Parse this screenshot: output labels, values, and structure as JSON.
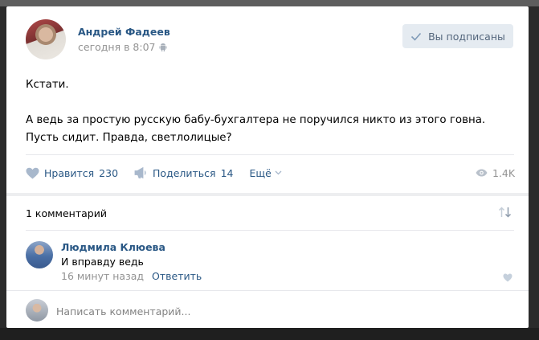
{
  "post": {
    "author_name": "Андрей Фадеев",
    "timestamp": "сегодня в 8:07",
    "platform_icon": "android-icon",
    "subscribe_label": "Вы подписаны",
    "text_lines": [
      "Кстати.",
      "А ведь за простую русскую бабу-бухгалтера не поручился никто из этого говна.",
      "Пусть сидит. Правда, светлолицые?"
    ]
  },
  "actions": {
    "like_label": "Нравится",
    "like_count": "230",
    "share_label": "Поделиться",
    "share_count": "14",
    "more_label": "Ещё",
    "views": "1.4K"
  },
  "comments": {
    "count_label": "1 комментарий",
    "items": [
      {
        "author": "Людмила Клюева",
        "text": "И вправду ведь",
        "time": "16 минут назад",
        "reply_label": "Ответить"
      }
    ]
  },
  "composer": {
    "placeholder": "Написать комментарий..."
  },
  "colors": {
    "link": "#2a5885",
    "muted": "#939393",
    "button_bg": "#e5ebf1"
  }
}
